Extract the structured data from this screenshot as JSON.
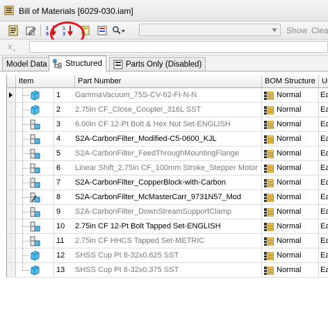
{
  "window": {
    "title": "Bill of Materials [6029-030.iam]"
  },
  "toolbar": {
    "buttons": [
      {
        "icon": "properties-icon"
      },
      {
        "icon": "edit-icon"
      },
      {
        "icon": "sort-descending-icon"
      },
      {
        "icon": "renumber-icon"
      },
      {
        "icon": "export-icon"
      },
      {
        "icon": "view-options-icon"
      },
      {
        "icon": "find-icon"
      }
    ],
    "show_label": "Show",
    "clear_label": "Clea"
  },
  "formula_bar": {
    "fx_label": "x",
    "value": ""
  },
  "tabs": [
    {
      "label": "Model Data",
      "active": false
    },
    {
      "label": "Structured",
      "active": true
    },
    {
      "label": "Parts Only (Disabled)",
      "active": false
    }
  ],
  "columns": {
    "item": "Item",
    "part_number": "Part Number",
    "bom_structure": "BOM Structure",
    "unit": "Un"
  },
  "rows": [
    {
      "item": "1",
      "part_number": "GammaVacuum_75S-CV-62-FI-N-N",
      "bom": "Normal",
      "unit": "Eac",
      "gray": true,
      "icon": "part-icon",
      "current": true
    },
    {
      "item": "2",
      "part_number": "2.75in CF_Close_Coupler_316L SST",
      "bom": "Normal",
      "unit": "Eac",
      "gray": true,
      "icon": "part-icon"
    },
    {
      "item": "3",
      "part_number": "6.00in CF 12-Pt Bolt & Hex Nut Set-ENGLISH",
      "bom": "Normal",
      "unit": "Eac",
      "gray": true,
      "icon": "assembly-icon"
    },
    {
      "item": "4",
      "part_number": "S2A-CarbonFilter_Modified-C5-0600_KJL",
      "bom": "Normal",
      "unit": "Eac",
      "gray": false,
      "icon": "assembly-icon"
    },
    {
      "item": "5",
      "part_number": "S2A-CarbonFilter_FeedThroughMountingFlange",
      "bom": "Normal",
      "unit": "Eac",
      "gray": true,
      "icon": "assembly-icon"
    },
    {
      "item": "6",
      "part_number": "Linear Shift_2.75in CF_100mm Stroke_Stepper Motor",
      "bom": "Normal",
      "unit": "Eac",
      "gray": true,
      "icon": "assembly-icon"
    },
    {
      "item": "7",
      "part_number": "S2A-CarbonFilter_CopperBlock-with-Carbon",
      "bom": "Normal",
      "unit": "Eac",
      "gray": false,
      "icon": "assembly-icon"
    },
    {
      "item": "8",
      "part_number": "S2A-CarbonFilter_McMasterCarr_9731N57_Mod",
      "bom": "Normal",
      "unit": "Eac",
      "gray": false,
      "icon": "assembly-edit-icon"
    },
    {
      "item": "9",
      "part_number": "S2A-CarbonFilter_DownStreamSupportClamp",
      "bom": "Normal",
      "unit": "Eac",
      "gray": true,
      "icon": "assembly-icon"
    },
    {
      "item": "10",
      "part_number": "2.75in CF 12-Pt Bolt Tapped Set-ENGLISH",
      "bom": "Normal",
      "unit": "Eac",
      "gray": false,
      "icon": "assembly-icon"
    },
    {
      "item": "11",
      "part_number": "2.75in CF HHCS Tapped Set-METRIC",
      "bom": "Normal",
      "unit": "Eac",
      "gray": true,
      "icon": "assembly-icon"
    },
    {
      "item": "12",
      "part_number": "SHSS Cup Pt 8-32x0.625 SST",
      "bom": "Normal",
      "unit": "Eac",
      "gray": true,
      "icon": "part-icon"
    },
    {
      "item": "13",
      "part_number": "SHSS Cup Pt 8-32x0.375 SST",
      "bom": "Normal",
      "unit": "Eac",
      "gray": true,
      "icon": "part-icon"
    }
  ],
  "colors": {
    "annotation": "#e8141c",
    "gray_text": "#7a7a7a",
    "part_blue": "#3fb3e6"
  }
}
